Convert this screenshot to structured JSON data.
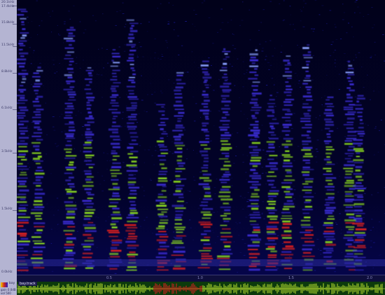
{
  "freq_axis": {
    "labels": [
      "20.1kHz",
      "17.4kHz",
      "15.8kHz",
      "11.5kHz",
      "8.8kHz",
      "6.1kHz",
      "3.5kHz",
      "1.5kHz",
      "0.0kHz"
    ]
  },
  "time_ruler": {
    "labels": [
      "0.5",
      "1.0",
      "1.5",
      "2.0"
    ]
  },
  "track": {
    "name": "bay",
    "tag": "bay.track",
    "meta": [
      "gain",
      "0.0dB",
      "vol",
      "500"
    ]
  },
  "colors": {
    "background": "#02021e",
    "low": "#3a2cd0",
    "mid": "#8ad820",
    "high": "#d82020",
    "waveform_bg": "#0c3a0c",
    "waveform": "#b8e030",
    "waveform_highlight": "#e02020"
  }
}
